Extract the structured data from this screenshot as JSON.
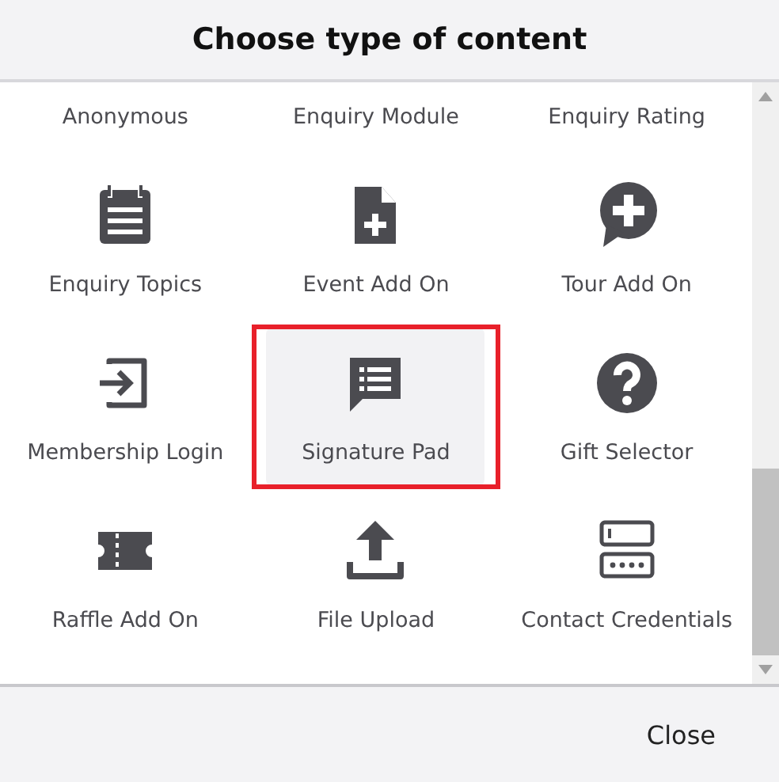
{
  "dialog": {
    "title": "Choose type of content"
  },
  "items": [
    {
      "kind": "label",
      "label": "Anonymous",
      "selected": false,
      "highlighted": false
    },
    {
      "kind": "label",
      "label": "Enquiry Module",
      "selected": false,
      "highlighted": false
    },
    {
      "kind": "label",
      "label": "Enquiry Rating",
      "selected": false,
      "highlighted": false
    },
    {
      "kind": "tile",
      "label": "Enquiry Topics",
      "selected": false,
      "highlighted": false
    },
    {
      "kind": "tile",
      "label": "Event Add On",
      "selected": false,
      "highlighted": false
    },
    {
      "kind": "tile",
      "label": "Tour Add On",
      "selected": false,
      "highlighted": false
    },
    {
      "kind": "tile",
      "label": "Membership Login",
      "selected": false,
      "highlighted": false
    },
    {
      "kind": "tile",
      "label": "Signature Pad",
      "selected": true,
      "highlighted": true
    },
    {
      "kind": "tile",
      "label": "Gift Selector",
      "selected": false,
      "highlighted": false
    },
    {
      "kind": "tile",
      "label": "Raffle Add On",
      "selected": false,
      "highlighted": false
    },
    {
      "kind": "tile",
      "label": "File Upload",
      "selected": false,
      "highlighted": false
    },
    {
      "kind": "tile",
      "label": "Contact Credentials",
      "selected": false,
      "highlighted": false
    }
  ],
  "footer": {
    "buttons": [
      "Close"
    ]
  }
}
